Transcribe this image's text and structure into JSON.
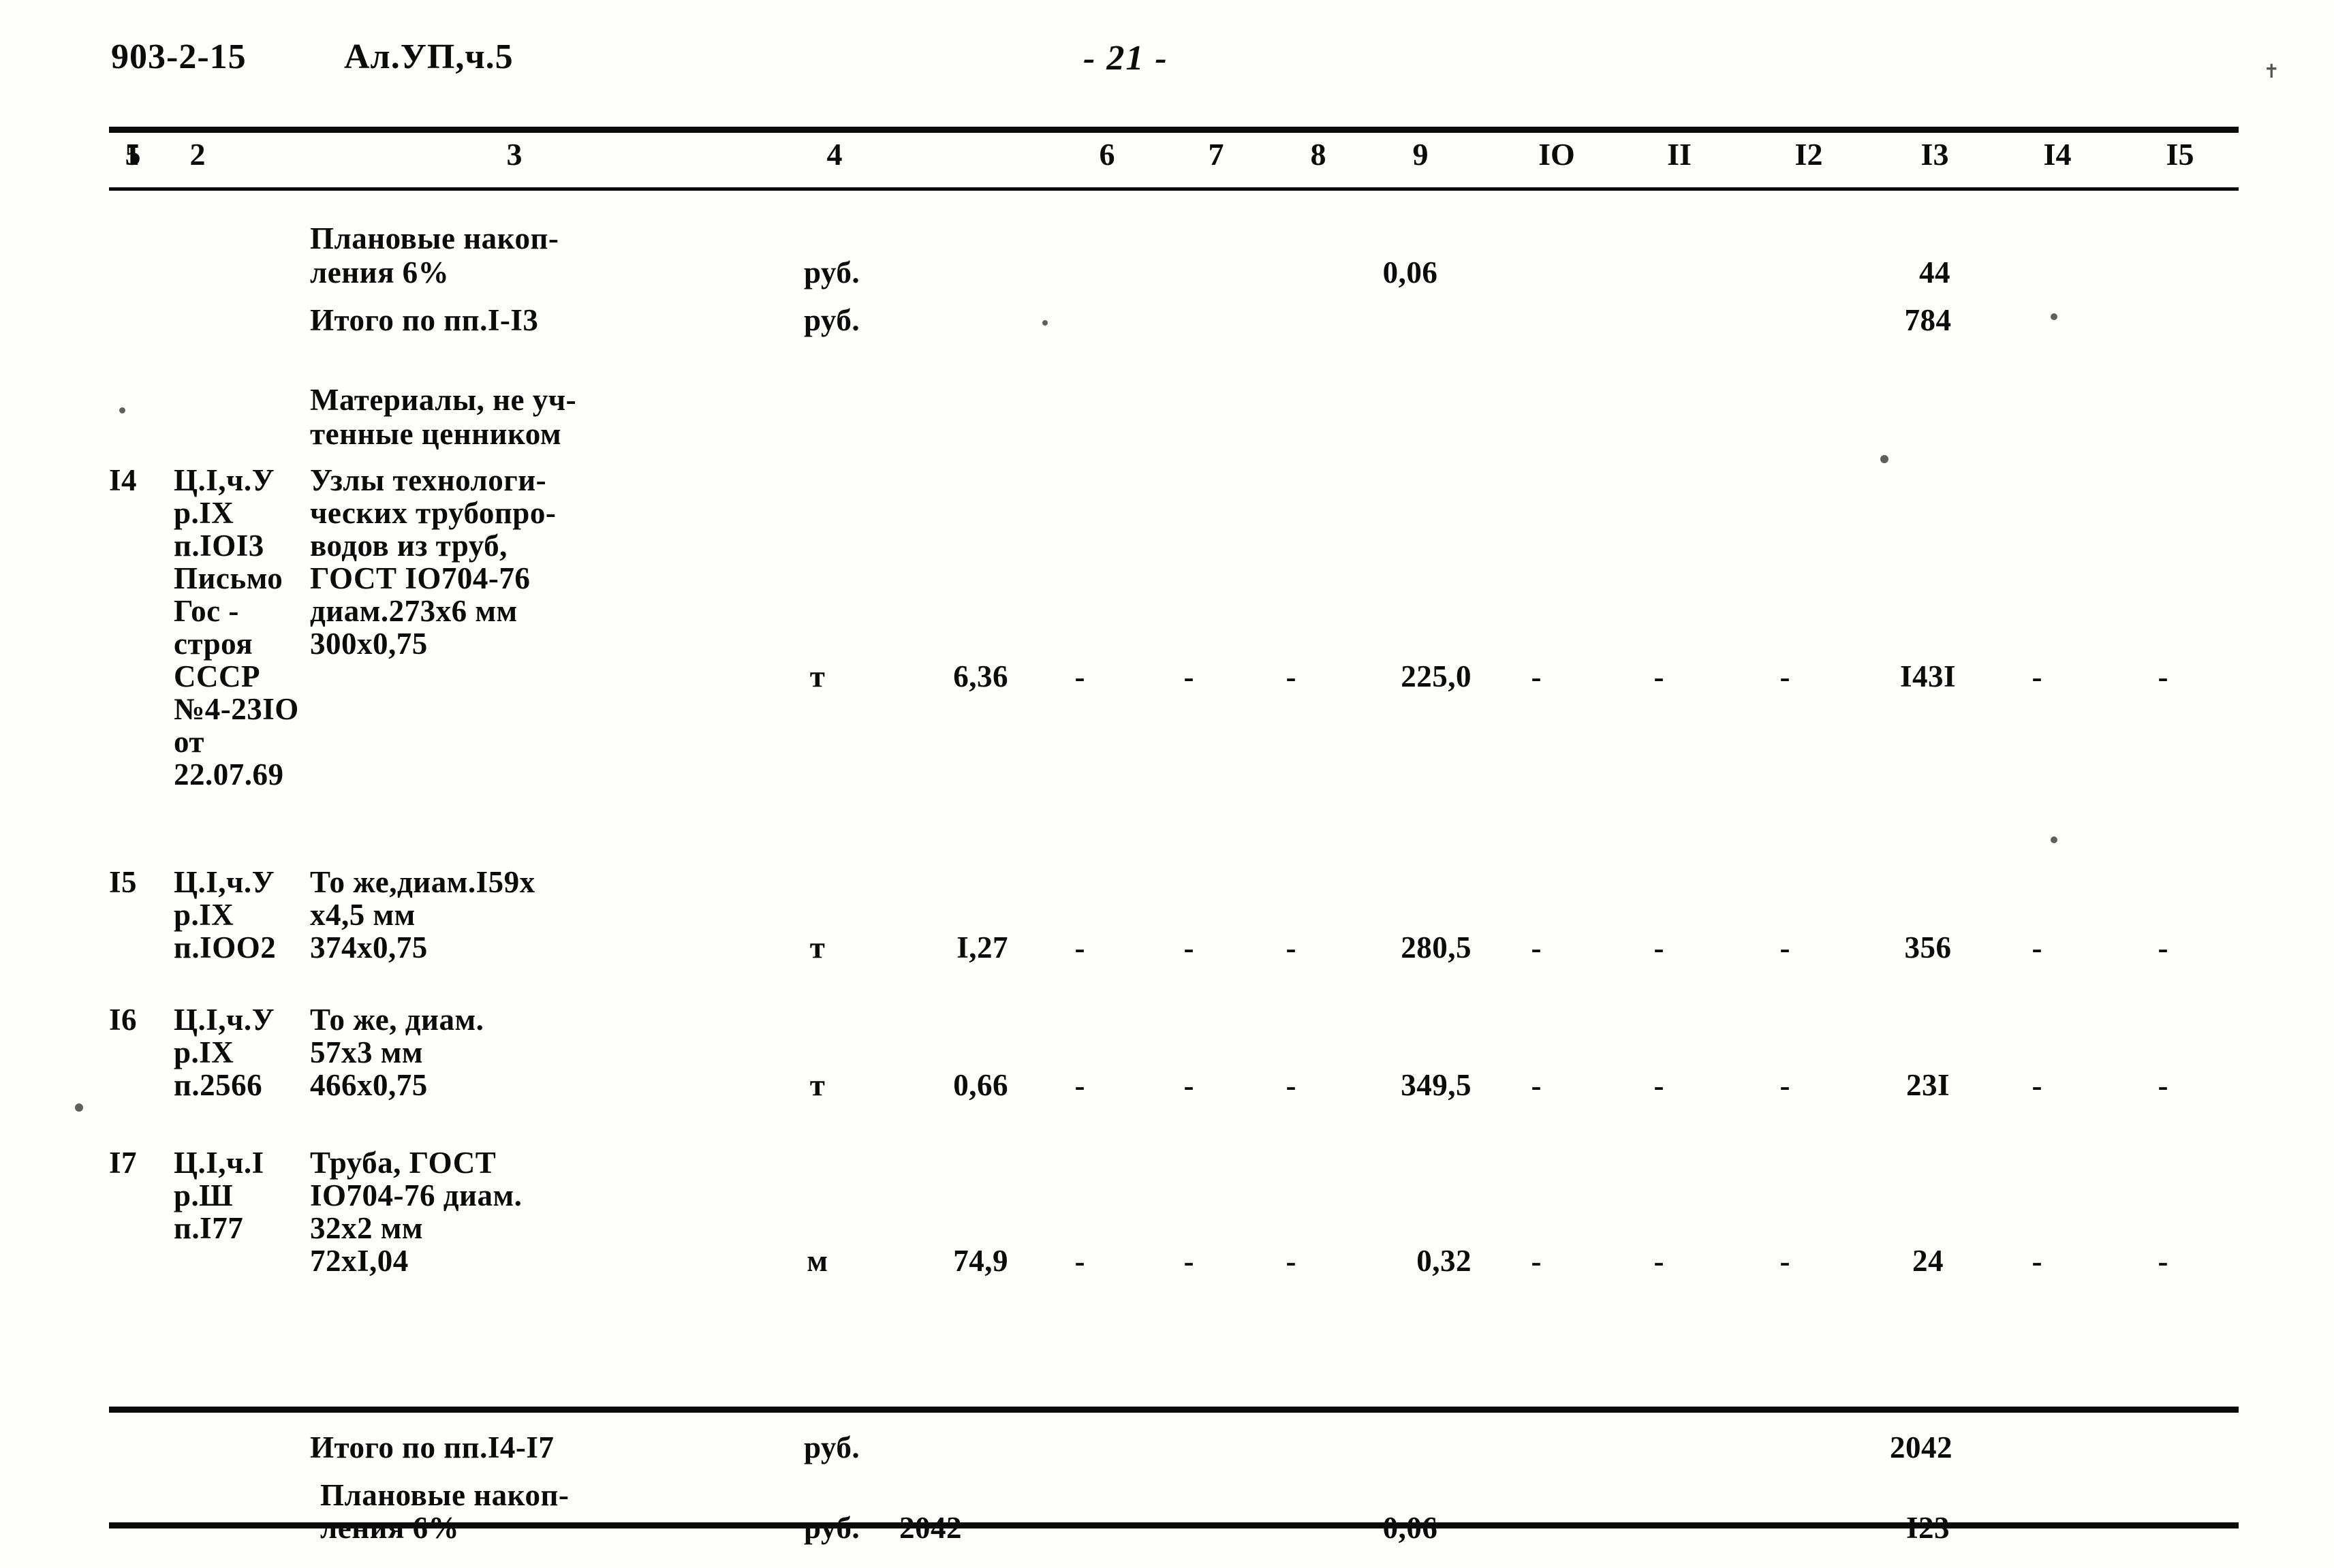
{
  "header": {
    "doc_code": "903-2-15",
    "album": "Ал.УП,ч.5",
    "page_number": "- 21 -"
  },
  "table": {
    "column_numbers": [
      "I",
      "2",
      "3",
      "4",
      "5",
      "6",
      "7",
      "8",
      "9",
      "IO",
      "II",
      "I2",
      "I3",
      "I4",
      "I5"
    ],
    "dash": "-",
    "rows": [
      {
        "id": "row-planovye-1",
        "num": "",
        "ref": "",
        "name_lines": [
          "Плановые накоп-",
          "ления 6%"
        ],
        "unit": "руб.",
        "qty": "",
        "c9": "0,06",
        "c13": "44",
        "dashes": false
      },
      {
        "id": "row-itogo-1-13",
        "num": "",
        "ref": "",
        "name_lines": [
          "Итого по пп.I-I3"
        ],
        "unit": "руб.",
        "qty": "",
        "c9": "",
        "c13": "784",
        "dashes": false
      },
      {
        "id": "row-materialy",
        "num": "",
        "ref": "",
        "name_lines": [
          "Материалы, не уч-",
          "тенные ценником"
        ],
        "unit": "",
        "qty": "",
        "c9": "",
        "c13": "",
        "dashes": false
      },
      {
        "id": "row-14",
        "num": "I4",
        "ref_lines": [
          "Ц.I,ч.У",
          "р.IX",
          "п.IOI3",
          "Письмо",
          "Гос -",
          "строя",
          "СССР",
          "№4-23IO",
          "от",
          "22.07.69"
        ],
        "name_lines": [
          "Узлы технологи-",
          "ческих трубопро-",
          "водов из труб,",
          "ГОСТ IO704-76",
          "диам.273х6 мм",
          "300х0,75"
        ],
        "unit": "т",
        "qty": "6,36",
        "c9": "225,0",
        "c13": "I43I",
        "dashes": true
      },
      {
        "id": "row-15",
        "num": "I5",
        "ref_lines": [
          "Ц.I,ч.У",
          "р.IX",
          "п.IOO2"
        ],
        "name_lines": [
          "То же,диам.I59х",
          "х4,5 мм",
          "374х0,75"
        ],
        "unit": "т",
        "qty": "I,27",
        "c9": "280,5",
        "c13": "356",
        "dashes": true
      },
      {
        "id": "row-16",
        "num": "I6",
        "ref_lines": [
          "Ц.I,ч.У",
          "р.IX",
          "п.2566"
        ],
        "name_lines": [
          "То же, диам.",
          "57х3 мм",
          "466х0,75"
        ],
        "unit": "т",
        "qty": "0,66",
        "c9": "349,5",
        "c13": "23I",
        "dashes": true
      },
      {
        "id": "row-17",
        "num": "I7",
        "ref_lines": [
          "Ц.I,ч.I",
          "р.Ш",
          "п.I77"
        ],
        "name_lines": [
          "Труба, ГОСТ",
          "IO704-76 диам.",
          "32х2 мм",
          "72хI,04"
        ],
        "unit": "м",
        "qty": "74,9",
        "c9": "0,32",
        "c13": "24",
        "dashes": true
      },
      {
        "id": "row-itogo-14-17",
        "num": "",
        "ref": "",
        "name_lines": [
          "Итого по пп.I4-I7"
        ],
        "unit": "руб.",
        "qty": "",
        "c9": "",
        "c13": "2042",
        "dashes": false
      },
      {
        "id": "row-planovye-2",
        "num": "",
        "ref": "",
        "name_lines": [
          "Плановые накоп-",
          "ления 6%"
        ],
        "unit": "руб.",
        "qty": "2042",
        "c9": "0,06",
        "c13": "I23",
        "dashes": false
      }
    ]
  }
}
